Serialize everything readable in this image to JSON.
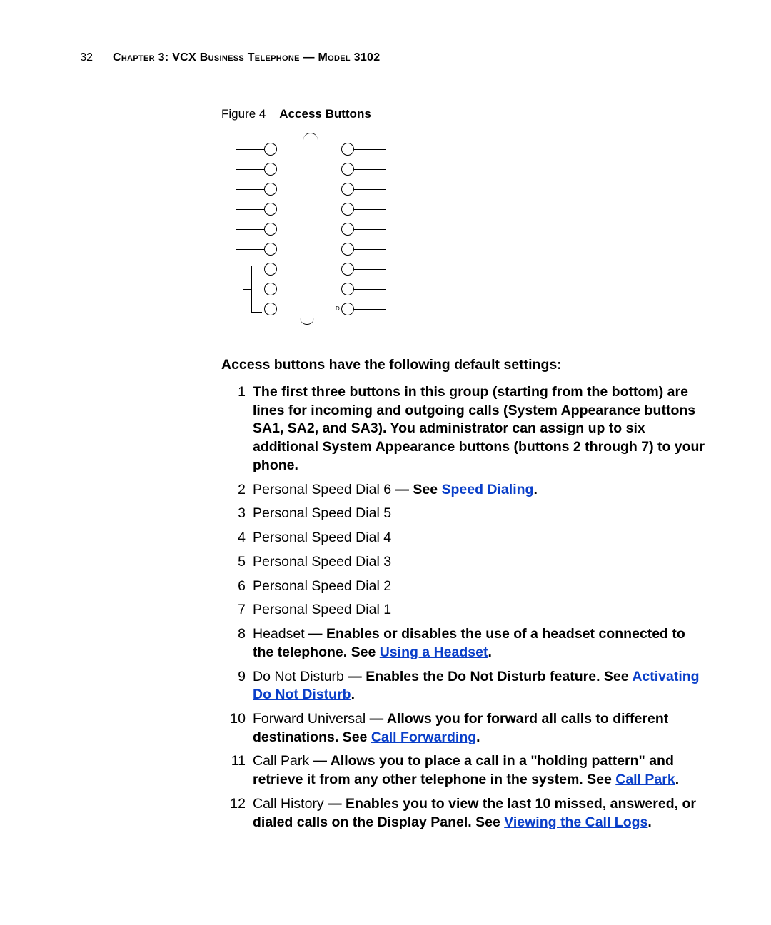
{
  "page_number": "32",
  "chapter_head": "Chapter 3: VCX Business Telephone — Model 3102",
  "figure": {
    "label_prefix": "Figure 4",
    "label_title": "Access Buttons",
    "small_d": "D"
  },
  "intro": "Access buttons have the following default settings:",
  "items": [
    {
      "n": "1",
      "bold_all": true,
      "lead": "",
      "plain": "The first three buttons in this group (starting from the bottom) are lines for incoming and outgoing calls (System Appearance buttons SA1, SA2, and SA3). You administrator can assign up to six additional System Appearance buttons (buttons 2 through 7) to your phone."
    },
    {
      "n": "2",
      "lead": "Personal Speed Dial 6",
      "bold_mid": " — See ",
      "link": "Speed Dialing",
      "bold_tail": "."
    },
    {
      "n": "3",
      "lead": "Personal Speed Dial 5"
    },
    {
      "n": "4",
      "lead": "Personal Speed Dial 4"
    },
    {
      "n": "5",
      "lead": "Personal Speed Dial 3"
    },
    {
      "n": "6",
      "lead": "Personal Speed Dial 2"
    },
    {
      "n": "7",
      "lead": "Personal Speed Dial 1"
    },
    {
      "n": "8",
      "lead": "Headset",
      "bold_mid": " — Enables or disables the use of a headset connected to the telephone. See ",
      "link": "Using a Headset",
      "bold_tail": "."
    },
    {
      "n": "9",
      "lead": "Do Not Disturb",
      "bold_mid": " — Enables the Do Not Disturb feature. See ",
      "link": "Activating Do Not Disturb",
      "bold_tail": "."
    },
    {
      "n": "10",
      "lead": "Forward Universal",
      "bold_mid": " — Allows you for forward all calls to different destinations. See ",
      "link": "Call Forwarding",
      "bold_tail": "."
    },
    {
      "n": "11",
      "lead": "Call Park",
      "bold_mid": " — Allows you to place a call in a \"holding pattern\" and retrieve it from any other telephone in the system. See ",
      "link": "Call Park",
      "bold_tail": "."
    },
    {
      "n": "12",
      "lead": "Call History",
      "bold_mid": " — Enables you to view the last 10 missed, answered, or dialed calls on the Display Panel. See ",
      "link": "Viewing the Call Logs",
      "bold_tail": "."
    }
  ]
}
